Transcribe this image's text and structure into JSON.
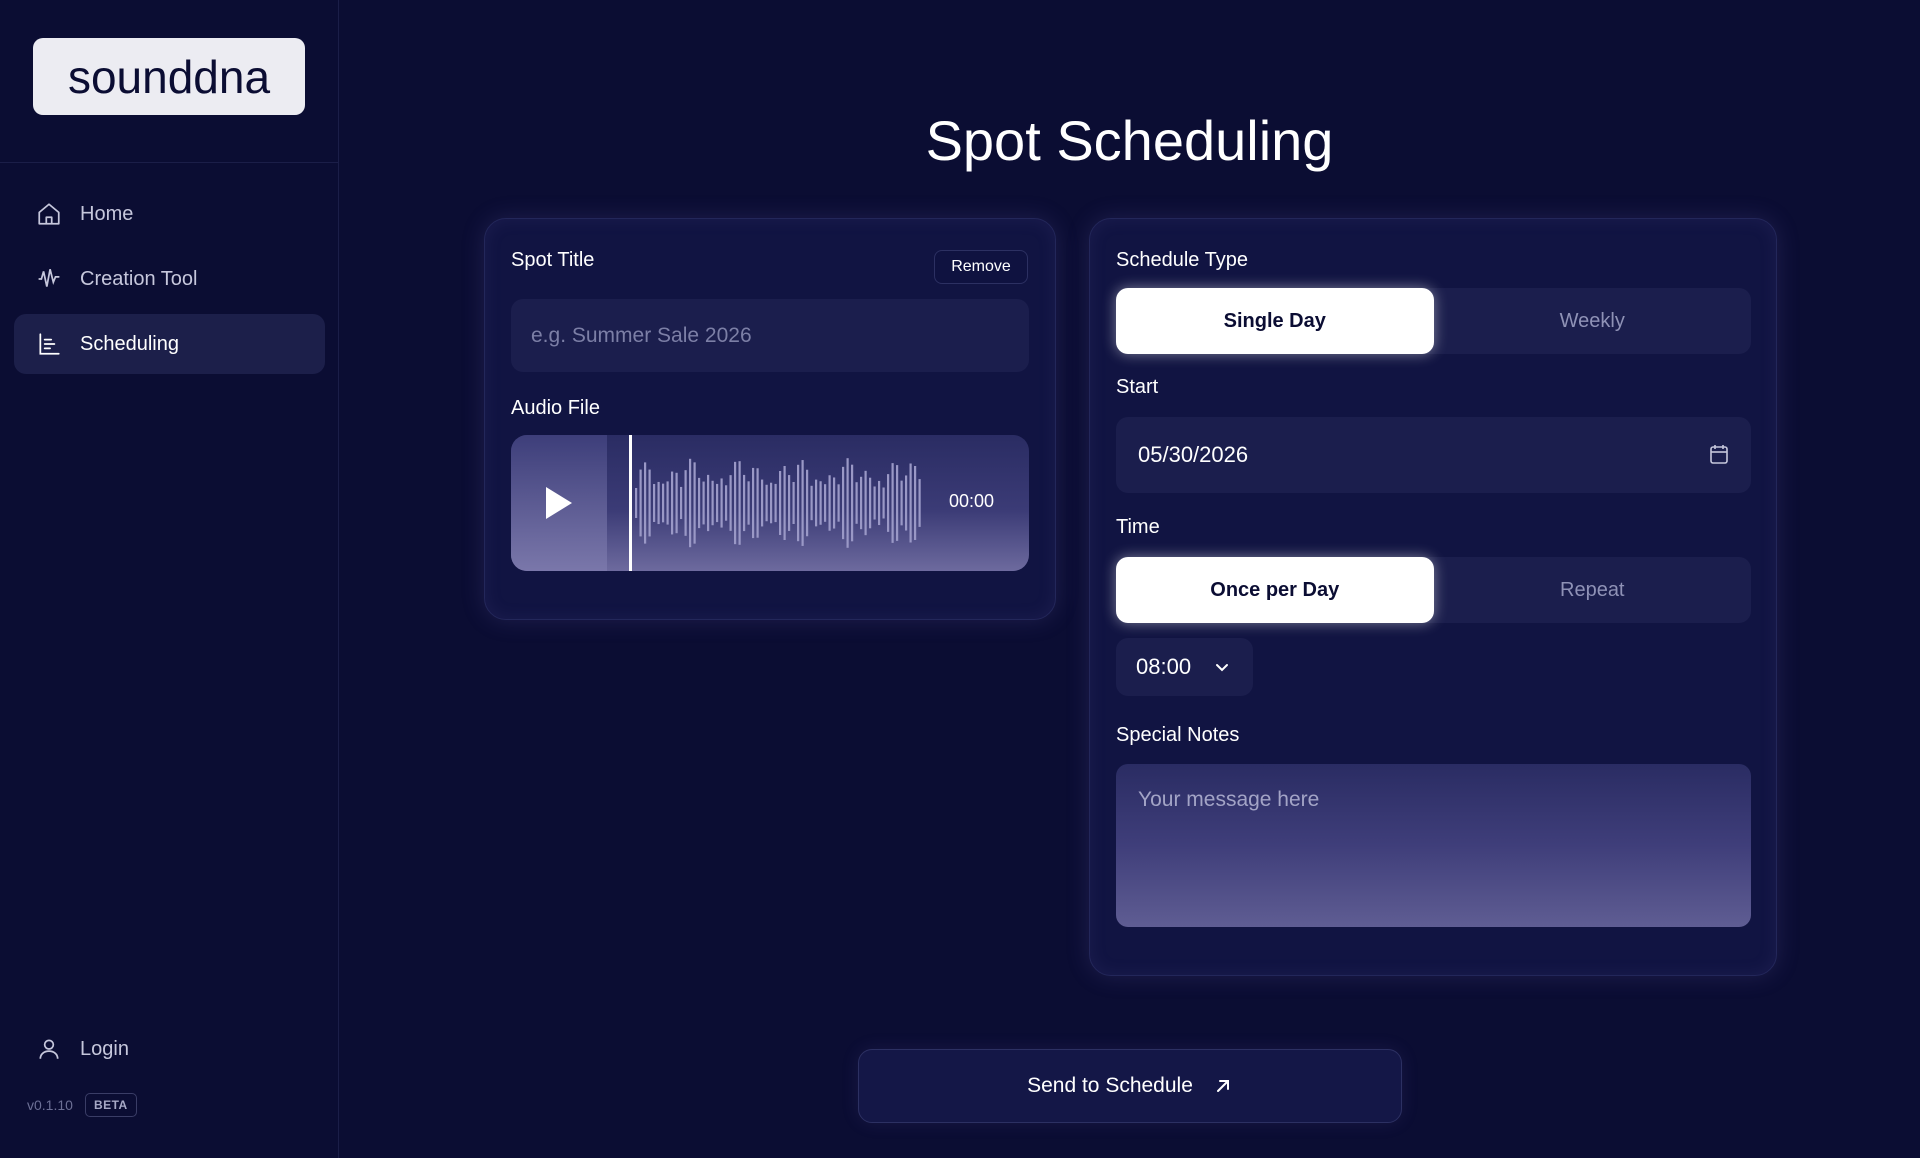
{
  "brand": {
    "logo_text": "sounddna"
  },
  "sidebar": {
    "items": [
      {
        "label": "Home",
        "icon": "home-icon",
        "active": false
      },
      {
        "label": "Creation Tool",
        "icon": "waveform-icon",
        "active": false
      },
      {
        "label": "Scheduling",
        "icon": "chart-icon",
        "active": true
      }
    ],
    "login_label": "Login",
    "version": "v0.1.10",
    "badge": "BETA"
  },
  "page": {
    "title": "Spot Scheduling"
  },
  "spot": {
    "title_label": "Spot Title",
    "remove_label": "Remove",
    "title_placeholder": "e.g. Summer Sale 2026",
    "title_value": "",
    "audio_label": "Audio File",
    "audio_time": "00:00"
  },
  "schedule": {
    "type_label": "Schedule Type",
    "type_options": [
      "Single Day",
      "Weekly"
    ],
    "type_selected": "Single Day",
    "start_label": "Start",
    "start_value": "05/30/2026",
    "time_label": "Time",
    "time_options": [
      "Once per Day",
      "Repeat"
    ],
    "time_selected": "Once per Day",
    "time_value": "08:00",
    "notes_label": "Special Notes",
    "notes_placeholder": "Your message here",
    "notes_value": ""
  },
  "actions": {
    "send_label": "Send to Schedule"
  },
  "colors": {
    "background": "#0b0d33",
    "card": "#111442",
    "input": "#1b1e4d",
    "active_nav": "#1c1f4a",
    "accent_text": "#ffffff",
    "muted_text": "#8f92b6"
  }
}
